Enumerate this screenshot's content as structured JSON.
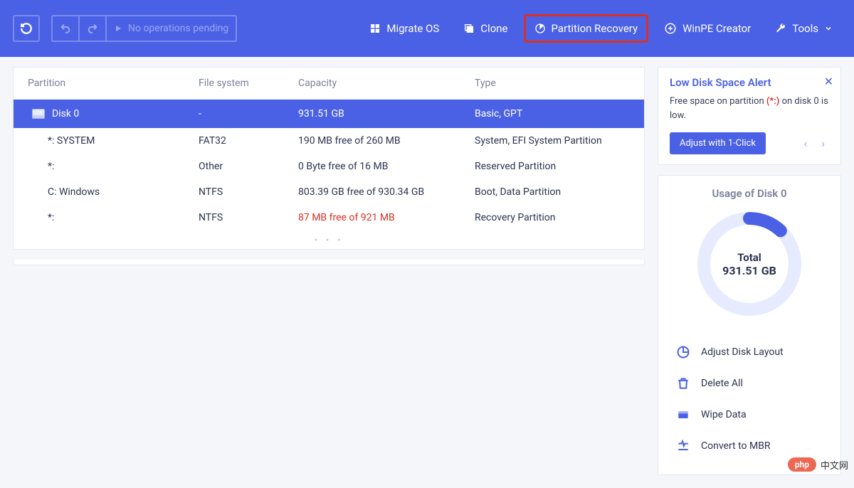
{
  "toolbar": {
    "pending_label": "No operations pending",
    "items": {
      "migrate": "Migrate OS",
      "clone": "Clone",
      "recovery": "Partition Recovery",
      "winpe": "WinPE Creator",
      "tools": "Tools"
    }
  },
  "table": {
    "headers": {
      "partition": "Partition",
      "fs": "File system",
      "capacity": "Capacity",
      "type": "Type"
    },
    "disk": {
      "name": "Disk 0",
      "fs": "-",
      "capacity": "931.51 GB",
      "type": "Basic, GPT"
    },
    "rows": [
      {
        "name": "*: SYSTEM",
        "fs": "FAT32",
        "capacity": "190 MB free of 260 MB",
        "type": "System, EFI System Partition",
        "low": false
      },
      {
        "name": "*:",
        "fs": "Other",
        "capacity": "0 Byte free of 16 MB",
        "type": "Reserved Partition",
        "low": false
      },
      {
        "name": "C: Windows",
        "fs": "NTFS",
        "capacity": "803.39 GB free of 930.34 GB",
        "type": "Boot, Data Partition",
        "low": false
      },
      {
        "name": "*:",
        "fs": "NTFS",
        "capacity": "87 MB free of 921 MB",
        "type": "Recovery Partition",
        "low": true
      }
    ]
  },
  "alert": {
    "title": "Low Disk Space Alert",
    "text_prefix": "Free space on partition ",
    "warn_token": "(*:)",
    "text_suffix": " on disk 0 is low.",
    "button": "Adjust with 1-Click"
  },
  "usage": {
    "title": "Usage of Disk 0",
    "total_label": "Total",
    "total_value": "931.51 GB",
    "used_ratio": 0.12
  },
  "actions": {
    "adjust": "Adjust Disk Layout",
    "delete": "Delete All",
    "wipe": "Wipe Data",
    "mbr": "Convert to MBR"
  },
  "watermark": {
    "badge": "php",
    "text": "中文网"
  },
  "chart_data": {
    "type": "pie",
    "title": "Usage of Disk 0",
    "series": [
      {
        "name": "Used",
        "value": 0.12
      },
      {
        "name": "Free",
        "value": 0.88
      }
    ],
    "center_label": "Total",
    "center_value": "931.51 GB"
  }
}
